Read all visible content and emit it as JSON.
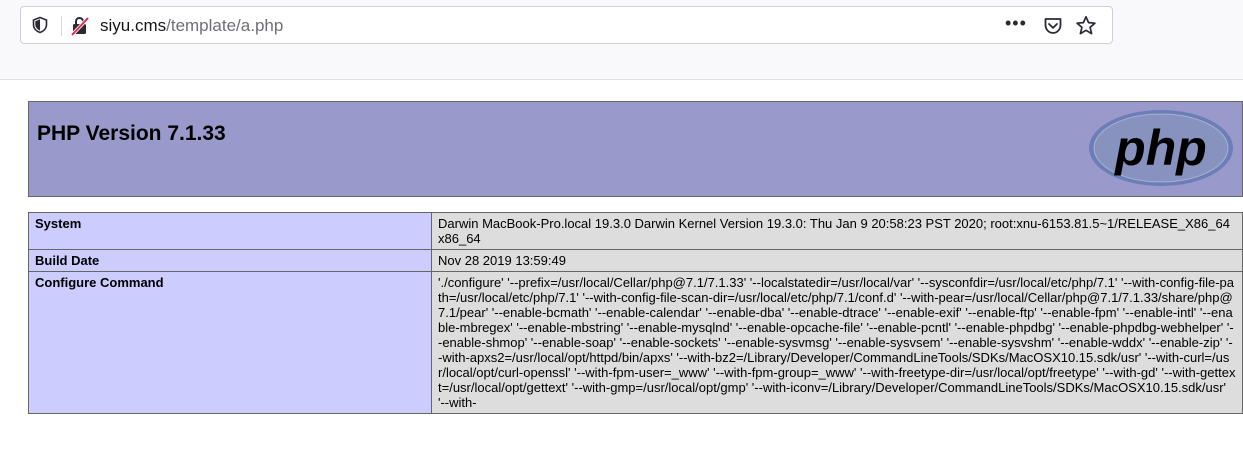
{
  "browser": {
    "url_host": "siyu.cms",
    "url_path": "/template/a.php",
    "more_label": "•••",
    "icons": [
      "shield-icon",
      "insecure-connection-icon",
      "pocket-icon",
      "bookmark-star-icon"
    ]
  },
  "header": {
    "title": "PHP Version 7.1.33",
    "logo_text": "php"
  },
  "rows": [
    {
      "key": "System",
      "value": "Darwin MacBook-Pro.local 19.3.0 Darwin Kernel Version 19.3.0: Thu Jan 9 20:58:23 PST 2020; root:xnu-6153.81.5~1/RELEASE_X86_64 x86_64"
    },
    {
      "key": "Build Date",
      "value": "Nov 28 2019 13:59:49"
    },
    {
      "key": "Configure Command",
      "value": "'./configure' '--prefix=/usr/local/Cellar/php@7.1/7.1.33' '--localstatedir=/usr/local/var' '--sysconfdir=/usr/local/etc/php/7.1' '--with-config-file-path=/usr/local/etc/php/7.1' '--with-config-file-scan-dir=/usr/local/etc/php/7.1/conf.d' '--with-pear=/usr/local/Cellar/php@7.1/7.1.33/share/php@7.1/pear' '--enable-bcmath' '--enable-calendar' '--enable-dba' '--enable-dtrace' '--enable-exif' '--enable-ftp' '--enable-fpm' '--enable-intl' '--enable-mbregex' '--enable-mbstring' '--enable-mysqlnd' '--enable-opcache-file' '--enable-pcntl' '--enable-phpdbg' '--enable-phpdbg-webhelper' '--enable-shmop' '--enable-soap' '--enable-sockets' '--enable-sysvmsg' '--enable-sysvsem' '--enable-sysvshm' '--enable-wddx' '--enable-zip' '--with-apxs2=/usr/local/opt/httpd/bin/apxs' '--with-bz2=/Library/Developer/CommandLineTools/SDKs/MacOSX10.15.sdk/usr' '--with-curl=/usr/local/opt/curl-openssl' '--with-fpm-user=_www' '--with-fpm-group=_www' '--with-freetype-dir=/usr/local/opt/freetype' '--with-gd' '--with-gettext=/usr/local/opt/gettext' '--with-gmp=/usr/local/opt/gmp' '--with-iconv=/Library/Developer/CommandLineTools/SDKs/MacOSX10.15.sdk/usr' '--with-"
    }
  ]
}
